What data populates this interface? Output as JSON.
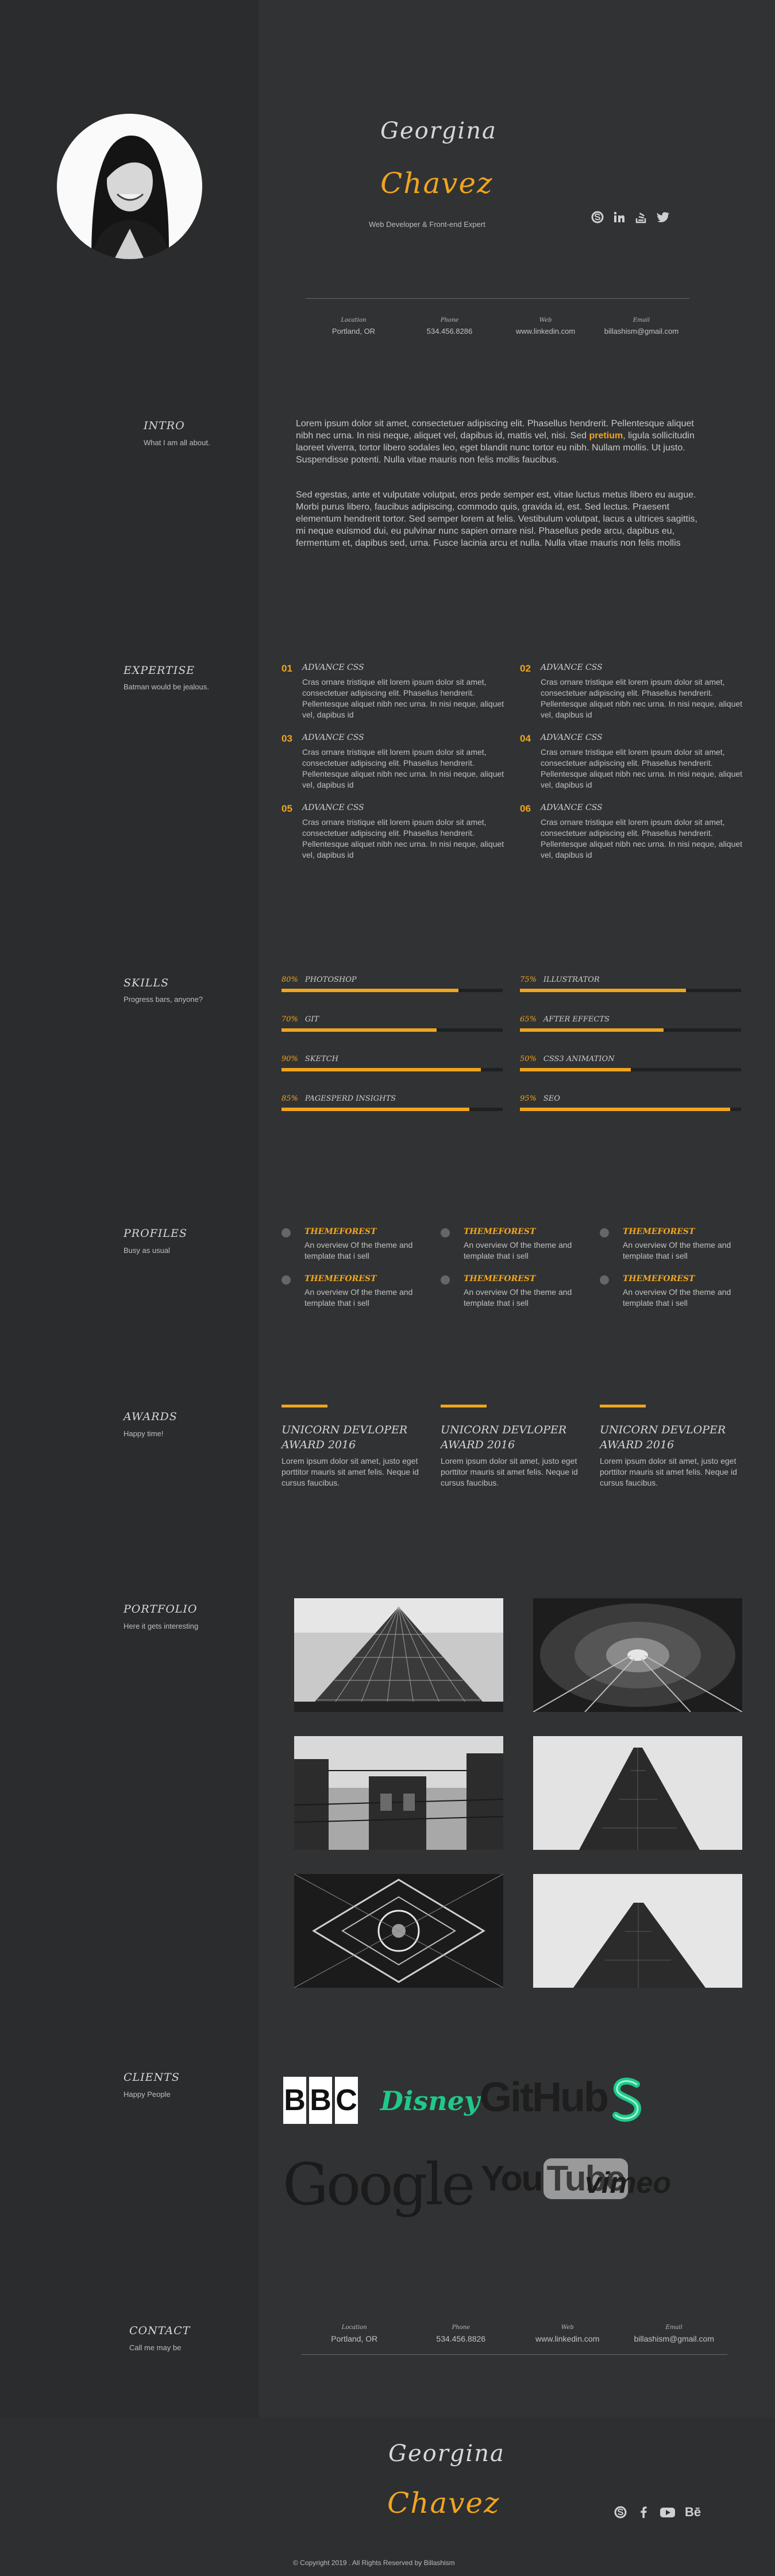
{
  "header": {
    "first_name": "Georgina",
    "last_name": "Chavez",
    "role": "Web Developer & Front-end Expert",
    "social": [
      "skype-icon",
      "linkedin-icon",
      "stackoverflow-icon",
      "twitter-icon"
    ],
    "contact": [
      {
        "label": "Location",
        "value": "Portland, OR"
      },
      {
        "label": "Phone",
        "value": "534.456.8286"
      },
      {
        "label": "Web",
        "value": "www.linkedin.com"
      },
      {
        "label": "Email",
        "value": "billashism@gmail.com"
      }
    ]
  },
  "intro": {
    "title": "INTRO",
    "subtitle": "What I am all about.",
    "p1_a": "Lorem ipsum dolor sit amet, consectetuer adipiscing elit. Phasellus hendrerit. Pellentesque aliquet nibh nec urna. In nisi neque, aliquet vel, dapibus id, mattis vel, nisi. Sed",
    "p1_highlight": "pretium",
    "p1_b": ", ligula sollicitudin laoreet viverra, tortor libero sodales leo, eget blandit nunc tortor eu nibh. Nullam mollis. Ut justo. Suspendisse potenti. Nulla vitae mauris non felis mollis faucibus.",
    "p2": "Sed egestas, ante et vulputate volutpat, eros pede semper est, vitae luctus metus libero eu augue. Morbi purus libero, faucibus adipiscing, commodo quis, gravida id, est. Sed lectus. Praesent elementum hendrerit tortor. Sed semper lorem at felis. Vestibulum volutpat, lacus a ultrices sagittis, mi neque euismod dui, eu pulvinar nunc sapien ornare nisl. Phasellus pede arcu, dapibus eu, fermentum et, dapibus sed, urna. Fusce lacinia arcu et nulla. Nulla vitae mauris non felis mollis"
  },
  "expertise": {
    "title": "EXPERTISE",
    "subtitle": "Batman would be jealous.",
    "items": [
      {
        "num": "01",
        "title": "ADVANCE CSS",
        "text": "Cras ornare tristique elit lorem ipsum dolor sit amet, consectetuer adipiscing elit. Phasellus hendrerit. Pellentesque aliquet nibh nec urna. In nisi neque, aliquet vel, dapibus id"
      },
      {
        "num": "02",
        "title": "ADVANCE CSS",
        "text": "Cras ornare tristique elit lorem ipsum dolor sit amet, consectetuer adipiscing elit. Phasellus hendrerit. Pellentesque aliquet nibh nec urna. In nisi neque, aliquet vel, dapibus id"
      },
      {
        "num": "03",
        "title": "ADVANCE CSS",
        "text": "Cras ornare tristique elit lorem ipsum dolor sit amet, consectetuer adipiscing elit. Phasellus hendrerit. Pellentesque aliquet nibh nec urna. In nisi neque, aliquet vel, dapibus id"
      },
      {
        "num": "04",
        "title": "ADVANCE CSS",
        "text": "Cras ornare tristique elit lorem ipsum dolor sit amet, consectetuer adipiscing elit. Phasellus hendrerit. Pellentesque aliquet nibh nec urna. In nisi neque, aliquet vel, dapibus id"
      },
      {
        "num": "05",
        "title": "ADVANCE CSS",
        "text": "Cras ornare tristique elit lorem ipsum dolor sit amet, consectetuer adipiscing elit. Phasellus hendrerit. Pellentesque aliquet nibh nec urna. In nisi neque, aliquet vel, dapibus id"
      },
      {
        "num": "06",
        "title": "ADVANCE CSS",
        "text": "Cras ornare tristique elit lorem ipsum dolor sit amet, consectetuer adipiscing elit. Phasellus hendrerit. Pellentesque aliquet nibh nec urna. In nisi neque, aliquet vel, dapibus id"
      }
    ]
  },
  "skills": {
    "title": "SKILLS",
    "subtitle": "Progress bars, anyone?",
    "items": [
      {
        "pct_label": "80%",
        "name": "PHOTOSHOP",
        "pct": 80
      },
      {
        "pct_label": "75%",
        "name": "ILLUSTRATOR",
        "pct": 75
      },
      {
        "pct_label": "70%",
        "name": "GIT",
        "pct": 70
      },
      {
        "pct_label": "65%",
        "name": "AFTER EFFECTS",
        "pct": 65
      },
      {
        "pct_label": "90%",
        "name": "SKETCH",
        "pct": 90
      },
      {
        "pct_label": "50%",
        "name": "CSS3 ANIMATION",
        "pct": 50
      },
      {
        "pct_label": "85%",
        "name": "PAGESPERD INSIGHTS",
        "pct": 85
      },
      {
        "pct_label": "95%",
        "name": "SEO",
        "pct": 95
      }
    ]
  },
  "profiles": {
    "title": "PROFILES",
    "subtitle": "Busy as usual",
    "items": [
      {
        "title": "THEMEFOREST",
        "text": "An overview Of the theme and template that i sell"
      },
      {
        "title": "THEMEFOREST",
        "text": "An overview Of the theme and template that i sell"
      },
      {
        "title": "THEMEFOREST",
        "text": "An overview Of the theme and template that i sell"
      },
      {
        "title": "THEMEFOREST",
        "text": "An overview Of the theme and template that i sell"
      },
      {
        "title": "THEMEFOREST",
        "text": "An overview Of the theme and template that i sell"
      },
      {
        "title": "THEMEFOREST",
        "text": "An overview Of the theme and template that i sell"
      }
    ]
  },
  "awards": {
    "title": "AWARDS",
    "subtitle": "Happy time!",
    "items": [
      {
        "title": "UNICORN DEVLOPER AWARD 2016",
        "text": "Lorem ipsum dolor sit amet, justo eget porttitor mauris sit amet felis. Neque id cursus faucibus."
      },
      {
        "title": "UNICORN DEVLOPER AWARD 2016",
        "text": "Lorem ipsum dolor sit amet, justo eget porttitor mauris sit amet felis. Neque id cursus faucibus."
      },
      {
        "title": "UNICORN DEVLOPER AWARD 2016",
        "text": "Lorem ipsum dolor sit amet, justo eget porttitor mauris sit amet felis. Neque id cursus faucibus."
      }
    ]
  },
  "portfolio": {
    "title": "PORTFOLIO",
    "subtitle": "Here it gets interesting"
  },
  "clients": {
    "title": "CLIENTS",
    "subtitle": "Happy People",
    "logos": {
      "bbc": [
        "B",
        "B",
        "C"
      ],
      "disney": "Disney",
      "github": "GitHub",
      "google": "Google",
      "youtube_you": "You",
      "youtube_tube": "Tube",
      "vimeo": "vimeo"
    }
  },
  "contact": {
    "title": "CONTACT",
    "subtitle": "Call me may be",
    "items": [
      {
        "label": "Location",
        "value": "Portland, OR"
      },
      {
        "label": "Phone",
        "value": "534.456.8826"
      },
      {
        "label": "Web",
        "value": "www.linkedin.com"
      },
      {
        "label": "Email",
        "value": "billashism@gmail.com"
      }
    ]
  },
  "footer": {
    "first_name": "Georgina",
    "last_name": "Chavez",
    "social": [
      "skype-icon",
      "facebook-icon",
      "youtube-icon",
      "behance-icon"
    ],
    "behance_text": "Bē",
    "copyright": "© Copyright 2019 . All Rights Reserved by Billashism"
  },
  "colors": {
    "accent": "#f0a51e",
    "bg_left": "#2b2c2d",
    "bg_right": "#313233",
    "track": "#1f2021"
  }
}
